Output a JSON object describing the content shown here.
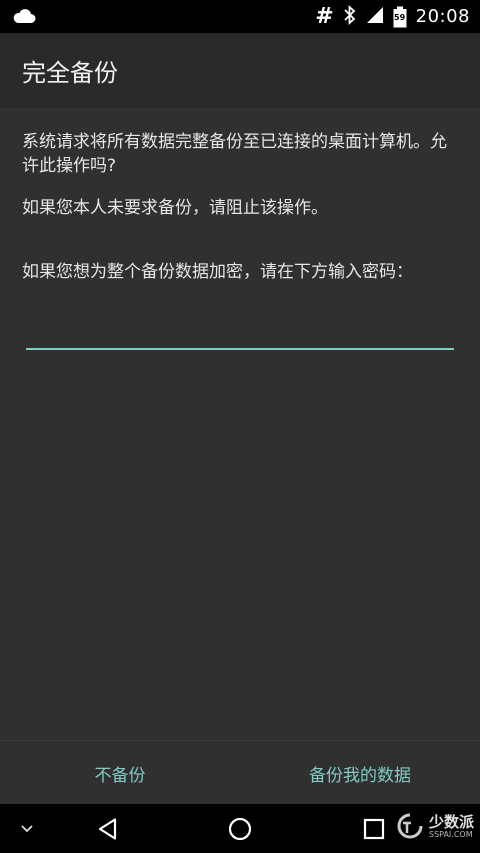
{
  "status_bar": {
    "time": "20:08",
    "hash_symbol": "#",
    "battery_level": "59",
    "icons": [
      "cloud-icon",
      "bluetooth-icon",
      "signal-icon",
      "battery-icon"
    ]
  },
  "dialog": {
    "title": "完全备份",
    "paragraph_1": "系统请求将所有数据完整备份至已连接的桌面计算机。允许此操作吗?",
    "paragraph_2": "如果您本人未要求备份，请阻止该操作。",
    "paragraph_3": "如果您想为整个备份数据加密，请在下方输入密码：",
    "password_value": "",
    "password_placeholder": ""
  },
  "buttons": {
    "deny_label": "不备份",
    "allow_label": "备份我的数据"
  },
  "nav_bar": {
    "items": [
      "chevron-down-icon",
      "back-icon",
      "home-icon",
      "recents-icon"
    ]
  },
  "watermark": {
    "text": "少数派",
    "sub": "SSPAI.COM"
  },
  "colors": {
    "accent": "#80cbc4",
    "content_bg": "#303030",
    "app_bar_bg": "#2a2a2a"
  }
}
